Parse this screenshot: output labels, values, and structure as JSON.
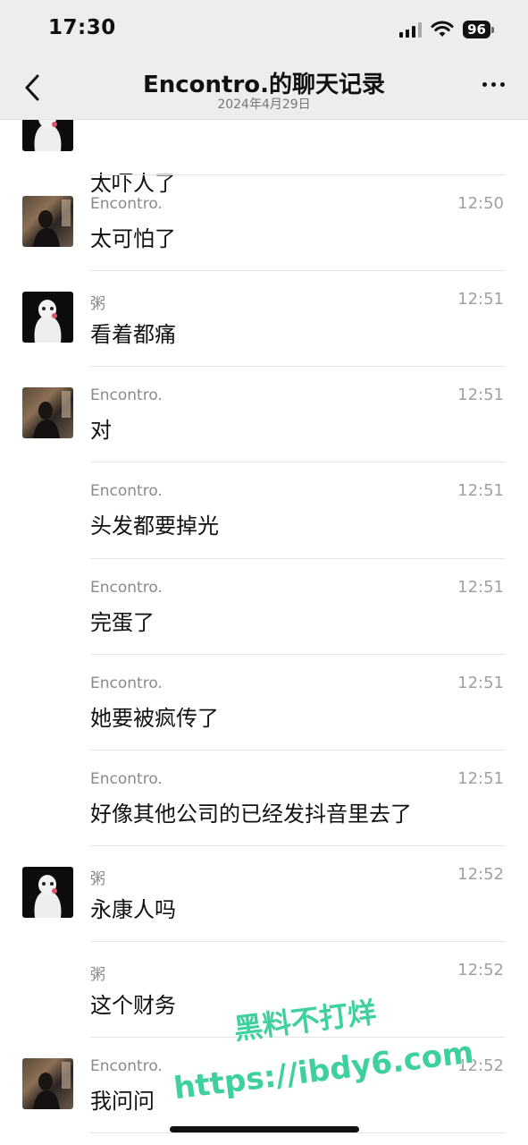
{
  "status": {
    "time": "17:30",
    "battery": "96"
  },
  "nav": {
    "title": "Encontro.的聊天记录",
    "subtitle": "2024年4月29日"
  },
  "messages": [
    {
      "name": "",
      "time": "",
      "text": "太吓人了",
      "avatar": "dark"
    },
    {
      "name": "Encontro.",
      "time": "12:50",
      "text": "太可怕了",
      "avatar": "photo"
    },
    {
      "name": "粥",
      "time": "12:51",
      "text": "看着都痛",
      "avatar": "dark"
    },
    {
      "name": "Encontro.",
      "time": "12:51",
      "text": "对",
      "avatar": "photo"
    },
    {
      "name": "Encontro.",
      "time": "12:51",
      "text": "头发都要掉光",
      "avatar": ""
    },
    {
      "name": "Encontro.",
      "time": "12:51",
      "text": "完蛋了",
      "avatar": ""
    },
    {
      "name": "Encontro.",
      "time": "12:51",
      "text": "她要被疯传了",
      "avatar": ""
    },
    {
      "name": "Encontro.",
      "time": "12:51",
      "text": "好像其他公司的已经发抖音里去了",
      "avatar": ""
    },
    {
      "name": "粥",
      "time": "12:52",
      "text": "永康人吗",
      "avatar": "dark"
    },
    {
      "name": "粥",
      "time": "12:52",
      "text": "这个财务",
      "avatar": ""
    },
    {
      "name": "Encontro.",
      "time": "12:52",
      "text": "我问问",
      "avatar": "photo"
    }
  ],
  "watermark": {
    "line1": "黑料不打烊",
    "line2": "https://ibdy6.com",
    "color": "#3fd0a0"
  },
  "icons": {
    "back": "chevron-left-icon",
    "more": "more-dots-icon"
  }
}
